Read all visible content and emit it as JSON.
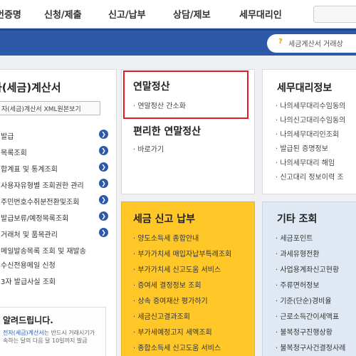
{
  "topnav": {
    "items": [
      "번증명",
      "신청/제출",
      "신고/납부",
      "상담/제보",
      "세무대리인"
    ]
  },
  "banner": {
    "notice_text": "세금계산서 거래상"
  },
  "left_panel": {
    "title": "자(세금)계산서",
    "xml_button": "자(세금)계산서 XML원본보기",
    "menu_items": [
      "발급",
      "목록조회",
      "합계표 및 통계조회",
      "사용자유형별 조회권한 관리",
      "주민번호수취분전환및조회",
      "발급보류/예정목록조회",
      "거래처 및 품목관리",
      "메일발송목록 조회 및 재발송"
    ],
    "plain_items": [
      "수신전용메일 신청",
      "3자 발급사실 조회"
    ],
    "notice": {
      "title": "알려드립니다.",
      "text_highlight": "전자(세금)계산서",
      "text_rest": "는 반드시 거래시기가 속하는 달의 다음 달 10일까지 발급"
    }
  },
  "year_end": {
    "title": "연말정산",
    "link": "연말정산 간소화"
  },
  "convenient": {
    "title": "편리한 연말정산",
    "link": "바로가기"
  },
  "agent": {
    "title": "세무대리정보",
    "links": [
      "나의세무대리수임동의",
      "나의신고대리수임동의",
      "나의세무대리인조회",
      "발급된 증명정보",
      "나의세무대리 해임",
      "신고대리 정보이력 조"
    ]
  },
  "tax": {
    "title": "세금 신고 납부",
    "links": [
      "양도소득세 종합안내",
      "부가가치세 매입자납부특례조회",
      "부가가치세 신고도움 서비스",
      "증여세 결정정보 조회",
      "상속 증여재산 평가하기",
      "세금신고결과조회",
      "부가세예정고지 세액조회",
      "종합소득세 신고도움 서비스"
    ]
  },
  "etc": {
    "title": "기타 조회",
    "links": [
      "세금포인트",
      "과세유형전환",
      "사업용계좌신고현황",
      "주류면허정보",
      "기준(단순)경비율",
      "근로소득간이세액표",
      "불복청구진행상황",
      "불복청구사건결정사례"
    ]
  },
  "colors": {
    "primary_blue": "#2d5aa8",
    "highlight_red": "#e21b23",
    "tax_yellow": "#ffc828",
    "etc_lightblue": "#dfe8f3"
  }
}
